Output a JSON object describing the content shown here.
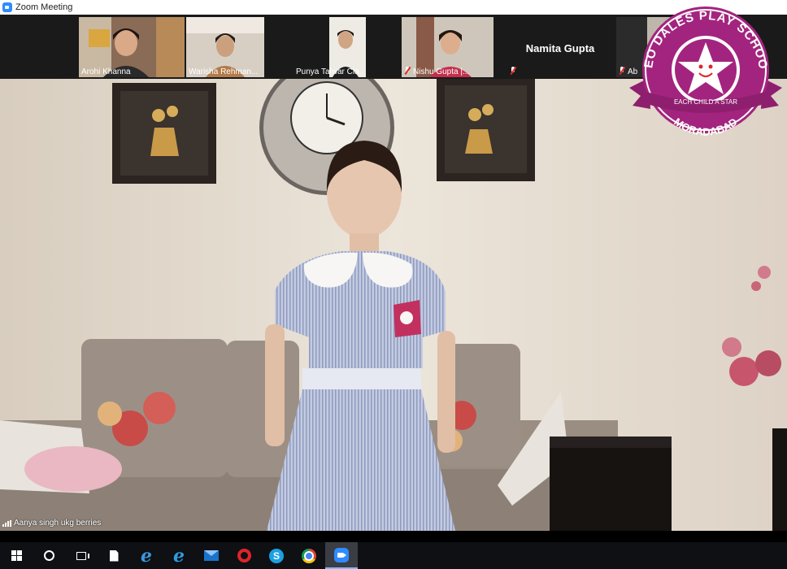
{
  "window": {
    "title": "Zoom Meeting"
  },
  "gallery": {
    "participants": [
      {
        "name": "Arohi Khanna",
        "muted": false
      },
      {
        "name": "Warisha Rehman...",
        "muted": false
      },
      {
        "name": "Punya Talwar Cla...",
        "muted": false
      },
      {
        "name": "Nishu Gupta |...",
        "muted": true
      },
      {
        "name": "Namita Gupta",
        "muted": true,
        "video": false
      },
      {
        "name": "Ab",
        "muted": true
      }
    ]
  },
  "active_speaker": {
    "name": "Aanya singh ukg berries"
  },
  "logo": {
    "top_text": "NEO DALES PLAY SCHOOL",
    "ribbon_text": "EACH CHILD A STAR",
    "bottom_text": "MORADABAD",
    "color": "#a3247f"
  },
  "taskbar": {
    "items": [
      {
        "icon": "windows-start-icon"
      },
      {
        "icon": "cortana-search-icon"
      },
      {
        "icon": "task-view-icon"
      },
      {
        "icon": "file-icon"
      },
      {
        "icon": "edge-legacy-icon"
      },
      {
        "icon": "edge-icon"
      },
      {
        "icon": "mail-icon"
      },
      {
        "icon": "opera-icon"
      },
      {
        "icon": "skype-icon"
      },
      {
        "icon": "chrome-icon"
      },
      {
        "icon": "zoom-icon",
        "active": true
      }
    ]
  }
}
